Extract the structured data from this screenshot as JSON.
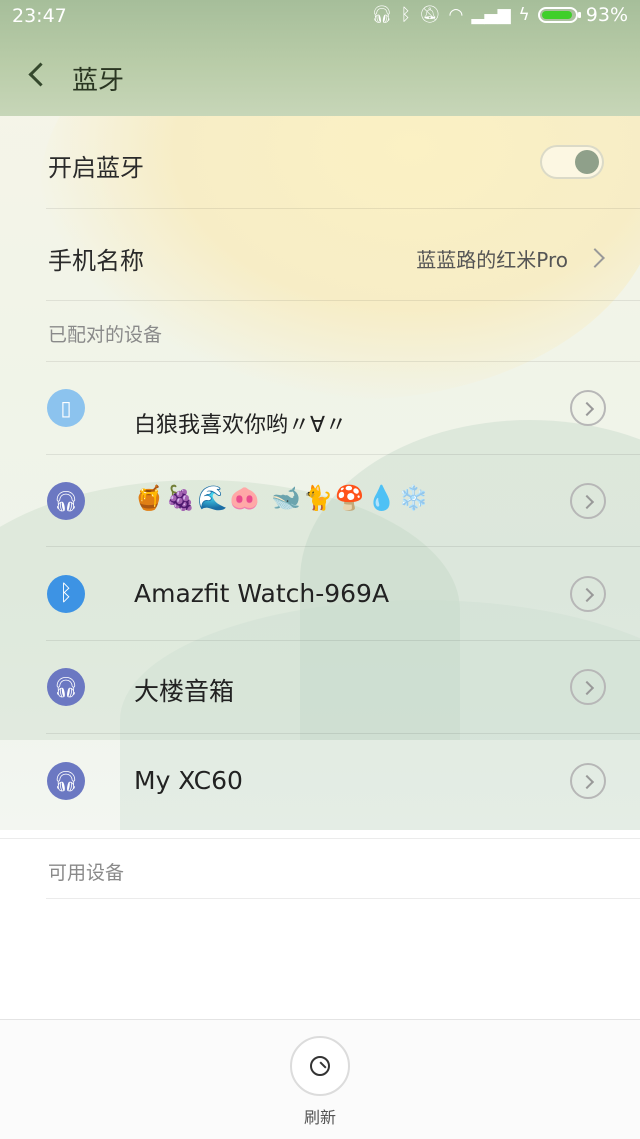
{
  "status_bar": {
    "time": "23:47",
    "battery_percent": "93%",
    "battery_level": 0.93,
    "icons": [
      "headset-icon",
      "bluetooth-icon",
      "dnd-icon",
      "wifi-icon",
      "signal-icon",
      "charging-icon",
      "battery-icon"
    ]
  },
  "nav": {
    "title": "蓝牙"
  },
  "settings": {
    "enable_label": "开启蓝牙",
    "enabled": true,
    "device_name_label": "手机名称",
    "device_name_value": "蓝蓝路的红米Pro"
  },
  "paired_section": {
    "title": "已配对的设备",
    "devices": [
      {
        "name": "白狼我喜欢你哟〃∀〃",
        "icon": "phone-icon",
        "icon_color": "#8cc3ee"
      },
      {
        "name": "🍯🍇🌊🐽      🐋🐈🍄💧❄️",
        "icon": "headset-icon",
        "icon_color": "#6b78c2"
      },
      {
        "name": "Amazfit Watch-969A",
        "icon": "bluetooth-icon",
        "icon_color": "#3d93e4"
      },
      {
        "name": "大楼音箱",
        "icon": "headset-icon",
        "icon_color": "#6b78c2"
      },
      {
        "name": "My XC60",
        "icon": "headset-icon",
        "icon_color": "#6b78c2"
      }
    ]
  },
  "available_section": {
    "title": "可用设备"
  },
  "bottom": {
    "refresh_label": "刷新"
  }
}
